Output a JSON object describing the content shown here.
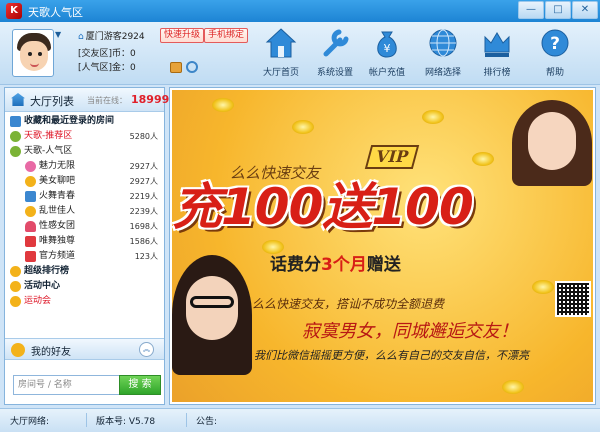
{
  "window": {
    "title": "天歌人气区",
    "min": "—",
    "max": "□",
    "close": "✕"
  },
  "user": {
    "name": "厦门游客2924",
    "upgrade_btn": "快速升级",
    "bind_btn": "手机绑定",
    "coin_label": "[交友区]币：",
    "coin_value": "0",
    "gold_label": "[人气区]金：",
    "gold_value": "0"
  },
  "nav": [
    {
      "label": "大厅首页",
      "icon": "home-icon"
    },
    {
      "label": "系统设置",
      "icon": "wrench-icon"
    },
    {
      "label": "帐户充值",
      "icon": "money-bag-icon"
    },
    {
      "label": "网络选择",
      "icon": "globe-icon"
    },
    {
      "label": "排行榜",
      "icon": "crown-icon"
    },
    {
      "label": "帮助",
      "icon": "question-icon"
    }
  ],
  "hall": {
    "title": "大厅列表",
    "online_label": "当前在线：",
    "online_count": "18999",
    "rooms": [
      {
        "label": "收藏和最近登录的房间",
        "count": "",
        "level": 0,
        "style": "bold",
        "icon": "house-icon"
      },
      {
        "label": "天歌-推荐区",
        "count": "5280人",
        "level": 0,
        "style": "red",
        "icon": "gourd-icon"
      },
      {
        "label": "天歌-人气区",
        "count": "",
        "level": 0,
        "style": "",
        "icon": "gourd-icon"
      },
      {
        "label": "魅力无限",
        "count": "2927人",
        "level": 1,
        "style": "",
        "icon": "pink-icon"
      },
      {
        "label": "美女聊吧",
        "count": "2927人",
        "level": 1,
        "style": "",
        "icon": "smile-icon"
      },
      {
        "label": "火舞青春",
        "count": "2219人",
        "level": 1,
        "style": "",
        "icon": "house-icon"
      },
      {
        "label": "乱世佳人",
        "count": "2239人",
        "level": 1,
        "style": "",
        "icon": "smile-icon"
      },
      {
        "label": "性感女团",
        "count": "1698人",
        "level": 1,
        "style": "",
        "icon": "heart-icon"
      },
      {
        "label": "唯舞独尊",
        "count": "1586人",
        "level": 1,
        "style": "",
        "icon": "red-icon"
      },
      {
        "label": "官方频道",
        "count": "123人",
        "level": 1,
        "style": "",
        "icon": "red-icon"
      },
      {
        "label": "超级排行榜",
        "count": "",
        "level": 0,
        "style": "bold",
        "icon": "smile-icon"
      },
      {
        "label": "活动中心",
        "count": "",
        "level": 0,
        "style": "bold",
        "icon": "smile-icon"
      },
      {
        "label": "运动会",
        "count": "",
        "level": 0,
        "style": "red",
        "icon": "smile-icon"
      }
    ]
  },
  "friends": {
    "label": "我的好友",
    "toggle": "︽"
  },
  "search": {
    "placeholder": "房间号 / 名称",
    "button": "搜 索"
  },
  "banner": {
    "vip": "VIP",
    "sub": "么么快速交友",
    "headline": "充100送100",
    "line1_pre": "话费分",
    "line1_hl": "3个月",
    "line1_post": "赠送",
    "line2": "么么快速交友，搭讪不成功全额退费",
    "line3": "寂寞男女，同城邂逅交友！",
    "line4": "我们比微信摇摇更方便，么么有自己的交友自信，不漂亮"
  },
  "status": {
    "network": "大厅网络:",
    "version": "版本号: V5.78",
    "notice": "公告:"
  }
}
